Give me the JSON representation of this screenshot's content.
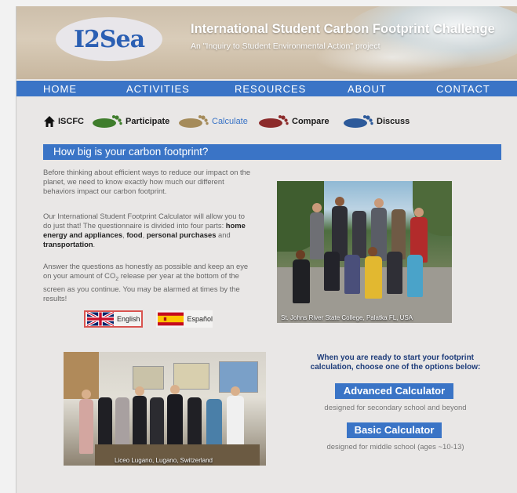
{
  "header": {
    "logo_text": "I2Sea",
    "title": "International Student Carbon Footprint Challenge",
    "subtitle": "An \"Inquiry to Student Environmental Action\" project"
  },
  "nav": {
    "items": [
      {
        "label": "HOME"
      },
      {
        "label": "ACTIVITIES"
      },
      {
        "label": "RESOURCES"
      },
      {
        "label": "ABOUT"
      },
      {
        "label": "CONTACT"
      }
    ]
  },
  "subnav": {
    "items": [
      {
        "label": "ISCFC",
        "icon": "home-icon"
      },
      {
        "label": "Participate",
        "icon": "green-footprint-icon",
        "color": "#3f7d2c"
      },
      {
        "label": "Calculate",
        "icon": "tan-footprint-icon",
        "color": "#a58b5a",
        "active": true
      },
      {
        "label": "Compare",
        "icon": "red-footprint-icon",
        "color": "#8c2b2b"
      },
      {
        "label": "Discuss",
        "icon": "blue-footprint-icon",
        "color": "#2d5a9a"
      }
    ]
  },
  "main": {
    "banner": "How big is your carbon footprint?",
    "para1": "Before thinking about efficient ways to reduce our impact on the planet, we need to know exactly how much our different behaviors impact our carbon footprint.",
    "para2_intro": "Our International Student Footprint Calculator will allow you to do just that! The questionnaire is divided into four parts: ",
    "para2_b1": "home energy and appliances",
    "para2_sep1": ", ",
    "para2_b2": "food",
    "para2_sep2": ", ",
    "para2_b3": "personal purchases",
    "para2_sep3": " and ",
    "para2_b4": "transportation",
    "para2_end": ".",
    "para3_a": "Answer the questions as honestly as possible and keep an eye on your amount of CO",
    "para3_sub": "2",
    "para3_b": " release per year at the bottom of the screen as you continue. You may be alarmed at times by the results!",
    "languages": [
      {
        "label": "English",
        "flag": "uk-flag-icon",
        "selected": true
      },
      {
        "label": "Español",
        "flag": "spain-flag-icon"
      }
    ],
    "photo1_caption": "St. Johns River State College, Palatka FL, USA",
    "photo2_caption": "Liceo Lugano, Lugano, Switzerland",
    "cta_text": "When you are ready to start your footprint calculation, choose one of the options below:",
    "advanced_label": "Advanced Calculator",
    "advanced_desc": "designed for secondary school and beyond",
    "basic_label": "Basic Calculator",
    "basic_desc": "designed for middle school (ages ~10-13)"
  },
  "colors": {
    "accent": "#3a74c6",
    "page_bg": "#e9e7e6",
    "highlight_border": "#d9534f"
  }
}
